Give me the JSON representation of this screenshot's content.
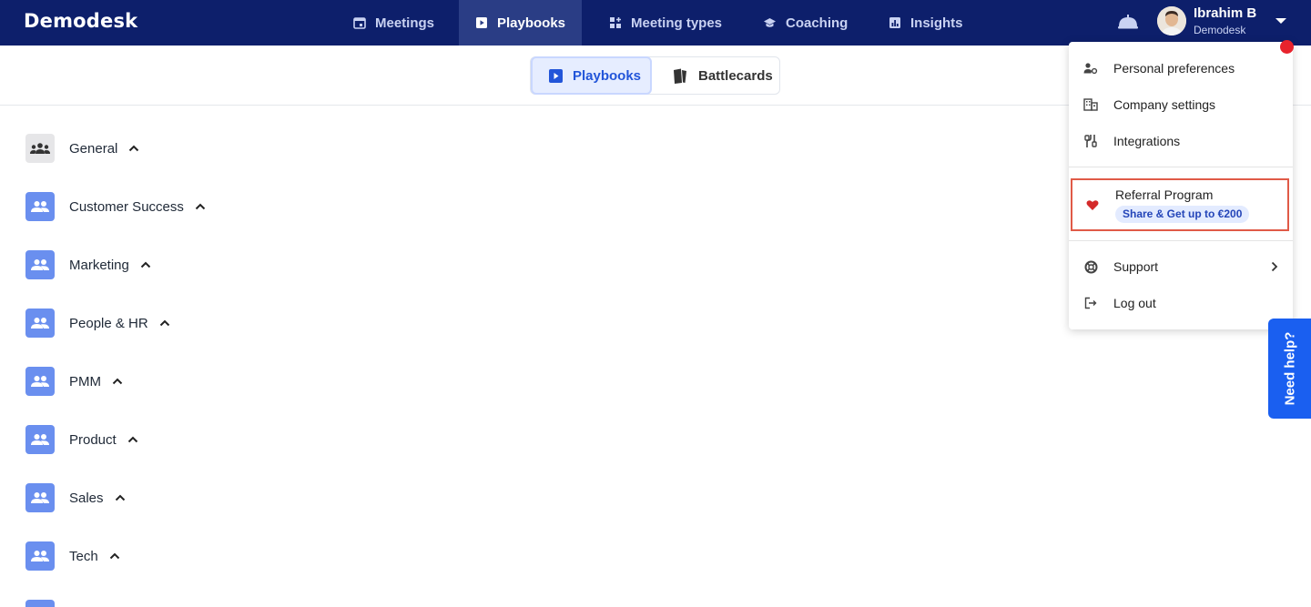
{
  "app": {
    "logo": "Demodesk"
  },
  "nav": {
    "items": [
      {
        "label": "Meetings",
        "icon": "calendar-icon"
      },
      {
        "label": "Playbooks",
        "icon": "play-square-icon",
        "active": true
      },
      {
        "label": "Meeting types",
        "icon": "grid-plus-icon"
      },
      {
        "label": "Coaching",
        "icon": "graduation-cap-icon"
      },
      {
        "label": "Insights",
        "icon": "bar-chart-icon"
      }
    ]
  },
  "user": {
    "name": "Ibrahim B",
    "org": "Demodesk"
  },
  "subtabs": {
    "playbooks": "Playbooks",
    "battlecards": "Battlecards"
  },
  "folders": [
    {
      "label": "General"
    },
    {
      "label": "Customer Success"
    },
    {
      "label": "Marketing"
    },
    {
      "label": "People & HR"
    },
    {
      "label": "PMM"
    },
    {
      "label": "Product"
    },
    {
      "label": "Sales"
    },
    {
      "label": "Tech"
    }
  ],
  "menu": {
    "personal_preferences": "Personal preferences",
    "company_settings": "Company settings",
    "integrations": "Integrations",
    "referral_title": "Referral Program",
    "referral_badge": "Share & Get up to €200",
    "support": "Support",
    "logout": "Log out"
  },
  "help": {
    "label": "Need help?"
  },
  "colors": {
    "nav_bg": "#0d1f6b",
    "accent": "#2255d9",
    "folder_icon": "#6a8fef",
    "highlight": "#e05a47",
    "notification": "#e8232d"
  }
}
